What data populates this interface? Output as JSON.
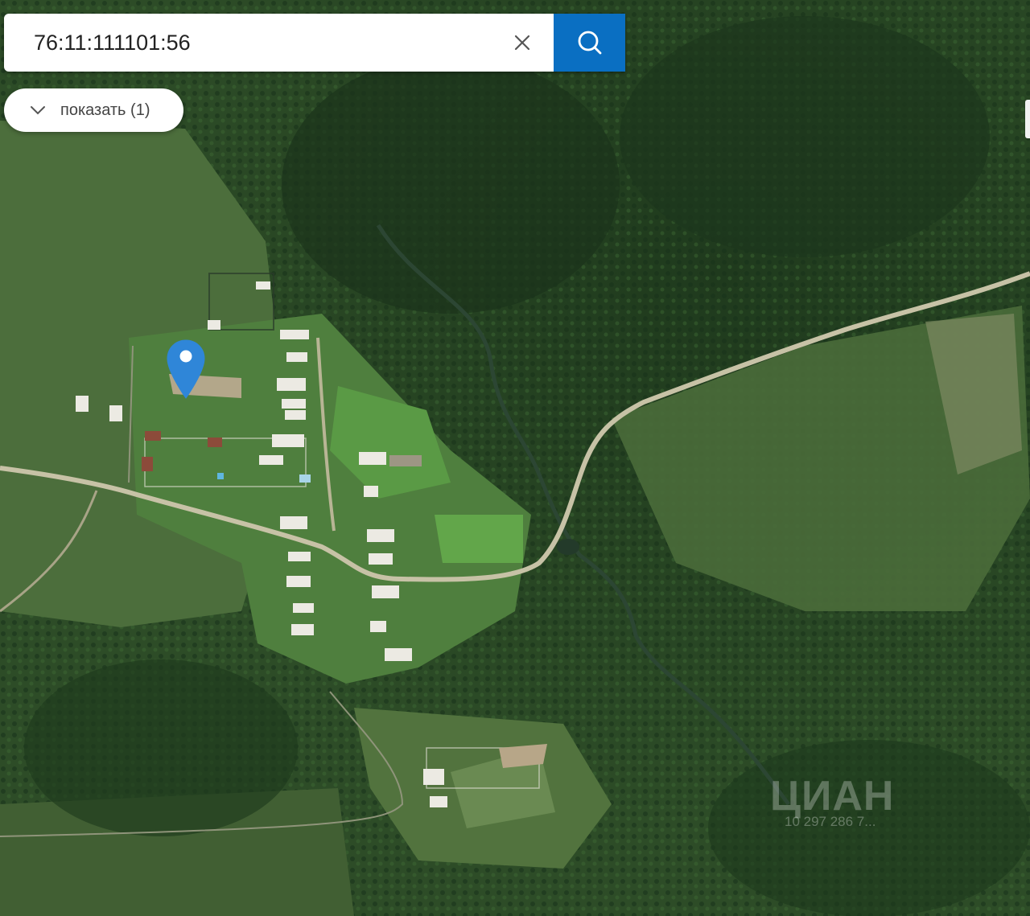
{
  "search": {
    "query": "76:11:111101:56",
    "clear_icon": "close-icon",
    "search_icon": "search-icon",
    "accent_color": "#0a6fc2"
  },
  "results_toggle": {
    "label": "показать (1)",
    "icon": "chevron-down-icon"
  },
  "map": {
    "view": "satellite",
    "marker_icon": "map-pin-icon",
    "marker_color": "#2f86d8"
  },
  "watermark": {
    "brand": "ЦИАН",
    "listing_id": "10 297 286 7..."
  }
}
